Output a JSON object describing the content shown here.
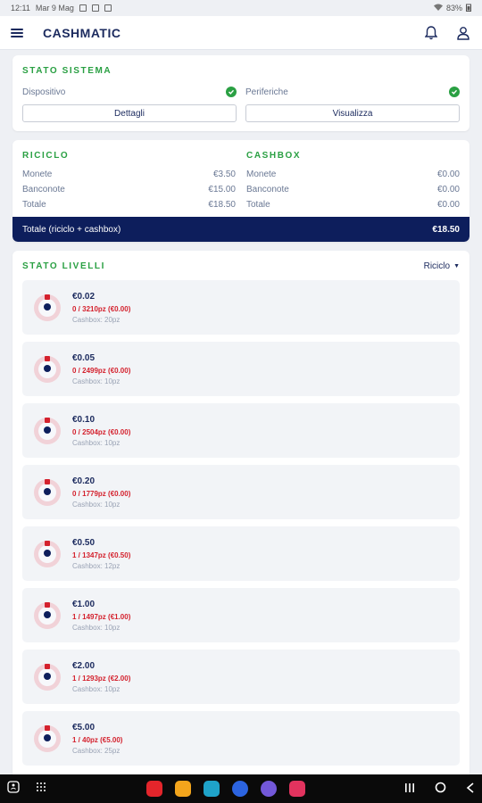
{
  "status_bar": {
    "time": "12:11",
    "date": "Mar 9 Mag",
    "battery": "83%"
  },
  "app": {
    "logo": "CASHMATIC"
  },
  "stato_sistema": {
    "title": "STATO SISTEMA",
    "dispositivo": {
      "label": "Dispositivo",
      "button": "Dettagli"
    },
    "periferiche": {
      "label": "Periferiche",
      "button": "Visualizza"
    }
  },
  "riciclo": {
    "title": "RICICLO",
    "monete_label": "Monete",
    "monete_value": "€3.50",
    "banconote_label": "Banconote",
    "banconote_value": "€15.00",
    "totale_label": "Totale",
    "totale_value": "€18.50"
  },
  "cashbox": {
    "title": "CASHBOX",
    "monete_label": "Monete",
    "monete_value": "€0.00",
    "banconote_label": "Banconote",
    "banconote_value": "€0.00",
    "totale_label": "Totale",
    "totale_value": "€0.00"
  },
  "totale_combined": {
    "label": "Totale (riciclo + cashbox)",
    "value": "€18.50"
  },
  "livelli": {
    "title": "STATO LIVELLI",
    "filter": "Riciclo",
    "coins": [
      {
        "denom": "€0.02",
        "count": "0 / 3210pz (€0.00)",
        "cashbox": "Cashbox: 20pz",
        "fill": 0.0
      },
      {
        "denom": "€0.05",
        "count": "0 / 2499pz (€0.00)",
        "cashbox": "Cashbox: 10pz",
        "fill": 0.0
      },
      {
        "denom": "€0.10",
        "count": "0 / 2504pz (€0.00)",
        "cashbox": "Cashbox: 10pz",
        "fill": 0.0
      },
      {
        "denom": "€0.20",
        "count": "0 / 1779pz (€0.00)",
        "cashbox": "Cashbox: 10pz",
        "fill": 0.0
      },
      {
        "denom": "€0.50",
        "count": "1 / 1347pz (€0.50)",
        "cashbox": "Cashbox: 12pz",
        "fill": 0.001
      },
      {
        "denom": "€1.00",
        "count": "1 / 1497pz (€1.00)",
        "cashbox": "Cashbox: 10pz",
        "fill": 0.001
      },
      {
        "denom": "€2.00",
        "count": "1 / 1293pz (€2.00)",
        "cashbox": "Cashbox: 10pz",
        "fill": 0.001
      },
      {
        "denom": "€5.00",
        "count": "1 / 40pz (€5.00)",
        "cashbox": "Cashbox: 25pz",
        "fill": 0.025
      }
    ]
  },
  "colors": {
    "accent_green": "#2aa043",
    "navy": "#0d1e5c",
    "alert_red": "#d4212d"
  },
  "nav_apps": [
    "flipboard",
    "notes",
    "calendar",
    "messages",
    "gallery",
    "camera"
  ]
}
